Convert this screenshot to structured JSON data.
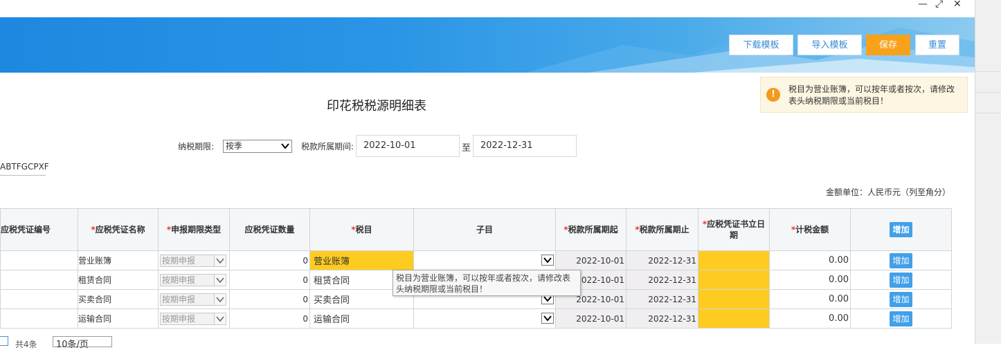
{
  "window": {
    "minimize": "—",
    "restore": "⤢",
    "close": "✕"
  },
  "header": {
    "buttons": {
      "download_template": "下载模板",
      "import_template": "导入模板",
      "save": "保存",
      "reset": "重置"
    }
  },
  "toast": {
    "icon": "!",
    "message": "税目为营业账簿，可以按年或者按次，请修改表头纳税期限或当前税目！"
  },
  "page_title": "印花税税源明细表",
  "filters": {
    "tax_period_label": "纳税期限:",
    "tax_period_value": "按季",
    "belong_period_label": "税款所属期间:",
    "date_from": "2022-10-01",
    "to_label": "至",
    "date_to": "2022-12-31"
  },
  "taxpayer_code_fragment": "ABTFGCPXF",
  "amount_unit": "金额单位：人民币元（列至角分）",
  "table": {
    "headers": {
      "voucher_no": "应税凭证编号",
      "voucher_name": "应税凭证名称",
      "period_type": "申报期限类型",
      "voucher_qty": "应税凭证数量",
      "tax_item": "税目",
      "sub_item": "子目",
      "period_start": "税款所属期起",
      "period_end": "税款所属期止",
      "issue_date": "应税凭证书立日期",
      "taxable_amount": "计税金额",
      "add_button": "增加",
      "required_mark": "*"
    },
    "rows": [
      {
        "voucher_name": "营业账簿",
        "period_type": "按期申报",
        "qty": "0",
        "tax_item": "营业账簿",
        "start": "2022-10-01",
        "end": "2022-12-31",
        "amount": "0.00",
        "action": "增加"
      },
      {
        "voucher_name": "租赁合同",
        "period_type": "按期申报",
        "qty": "0",
        "tax_item": "租赁合同",
        "start": "2022-10-01",
        "end": "2022-12-31",
        "amount": "0.00",
        "action": "增加"
      },
      {
        "voucher_name": "买卖合同",
        "period_type": "按期申报",
        "qty": "0",
        "tax_item": "买卖合同",
        "start": "2022-10-01",
        "end": "2022-12-31",
        "amount": "0.00",
        "action": "增加"
      },
      {
        "voucher_name": "运输合同",
        "period_type": "按期申报",
        "qty": "0",
        "tax_item": "运输合同",
        "start": "2022-10-01",
        "end": "2022-12-31",
        "amount": "0.00",
        "action": "增加"
      }
    ]
  },
  "tooltip": "税目为营业账簿，可以按年或者按次，请修改表头纳税期限或当前税目！",
  "pager": {
    "fragment": "共4条",
    "page_size": "10条/页"
  },
  "colors": {
    "accent_orange": "#f7a21a",
    "banner_blue": "#2a95e6",
    "highlight_yellow": "#fecc20",
    "add_button_blue": "#41a0e8"
  }
}
